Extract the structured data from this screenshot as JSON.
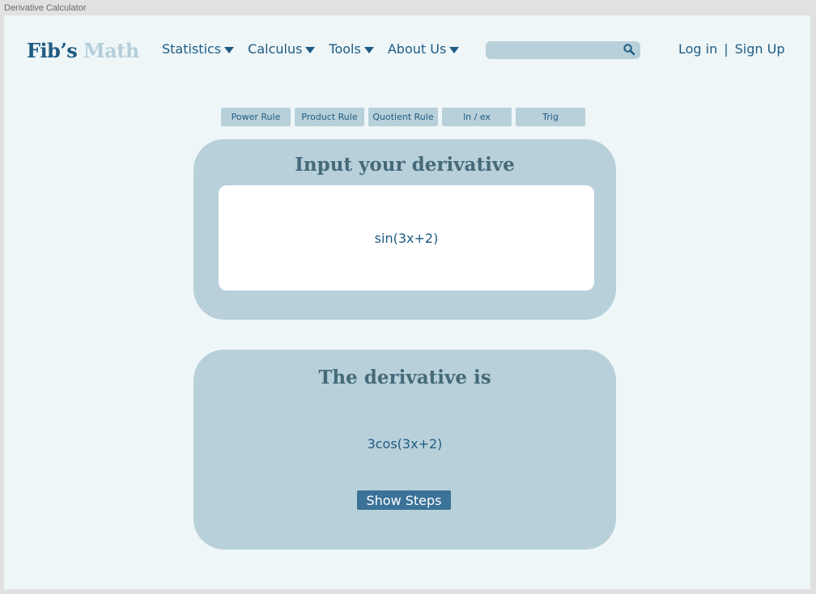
{
  "window": {
    "title": "Derivative Calculator"
  },
  "header": {
    "logo_part1": "Fib’s",
    "logo_part2": "Math",
    "nav": [
      {
        "label": "Statistics"
      },
      {
        "label": "Calculus"
      },
      {
        "label": "Tools"
      },
      {
        "label": "About Us"
      }
    ],
    "search": {
      "value": "",
      "placeholder": "",
      "icon": "search-icon"
    },
    "login_label": "Log in",
    "separator": "|",
    "signup_label": "Sign Up"
  },
  "tabs": [
    {
      "label": "Power Rule"
    },
    {
      "label": "Product Rule"
    },
    {
      "label": "Quotient Rule"
    },
    {
      "label": "ln / ex"
    },
    {
      "label": "Trig"
    }
  ],
  "input_card": {
    "title": "Input your derivative",
    "expression": "sin(3x+2)"
  },
  "result_card": {
    "title": "The derivative is",
    "expression": "3cos(3x+2)",
    "show_steps_label": "Show Steps"
  },
  "colors": {
    "brand_dark": "#1f5b82",
    "brand_light": "#b5cfd9",
    "panel": "#b8d0da",
    "background": "#eef6f8",
    "button": "#3b7298"
  }
}
